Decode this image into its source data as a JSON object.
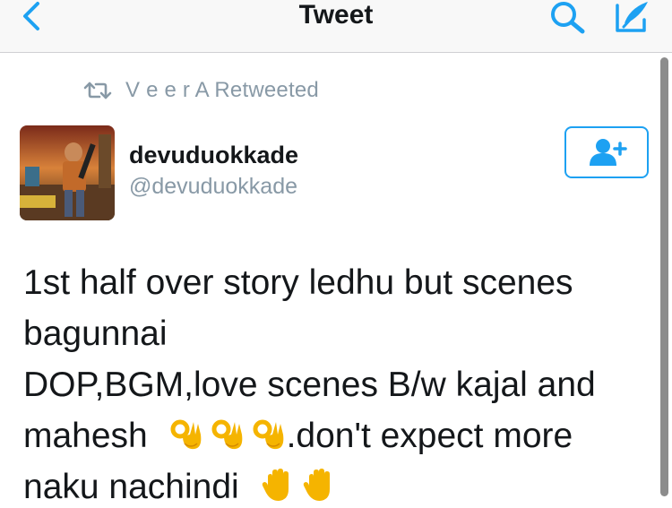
{
  "navbar": {
    "title": "Tweet",
    "back_icon": "chevron-left-icon",
    "search_icon": "search-icon",
    "compose_icon": "compose-icon",
    "accent": "#1da1f2"
  },
  "retweet_context": {
    "icon": "retweet-icon",
    "text": "V e e r A Retweeted"
  },
  "author": {
    "name": "devuduokkade",
    "handle": "@devuduokkade",
    "follow_icon": "add-user-icon"
  },
  "tweet": {
    "line1": "1st half over story ledhu but scenes",
    "line2": "bagunnai",
    "line3": "DOP,BGM,love scenes B/w kajal and",
    "line4_start": "mahesh",
    "line4_end": ".don't expect more",
    "line5_start": "naku nachindi",
    "ok_emoji": "ok-hand-emoji",
    "hand_emoji": "raised-hand-emoji"
  },
  "colors": {
    "text": "#14171a",
    "secondary": "#8899a6",
    "accent": "#1da1f2"
  }
}
